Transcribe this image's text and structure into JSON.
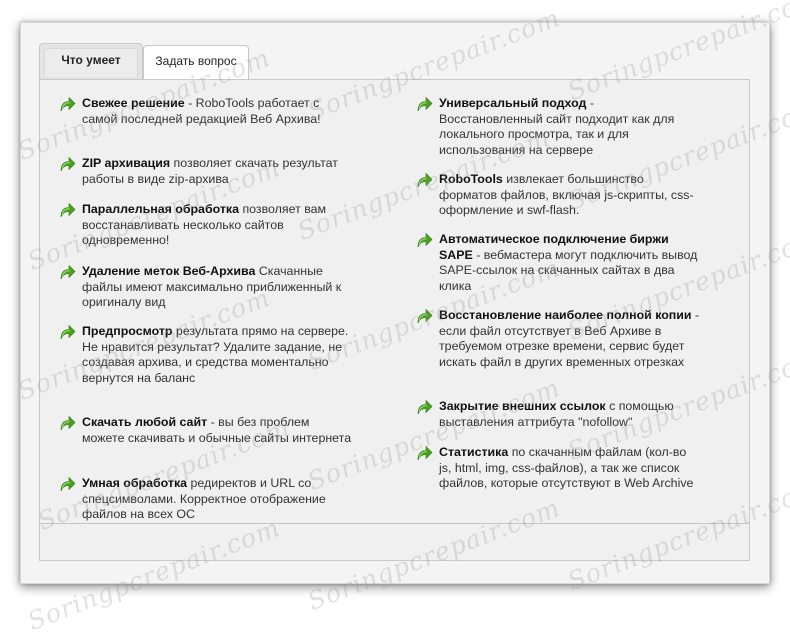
{
  "tabs": [
    {
      "label": "Что умеет",
      "active": true
    },
    {
      "label": "Задать вопрос",
      "active": false
    }
  ],
  "features_left": [
    {
      "title": "Свежее решение",
      "text": " - RoboTools работает с самой последней редакцией Веб Архива!"
    },
    {
      "title": "ZIP архивация",
      "text": " позволяет скачать результат работы в виде zip-архива"
    },
    {
      "title": "Параллельная обработка",
      "text": " позволяет вам восстанавливать несколько сайтов одновременно!"
    },
    {
      "title": "Удаление меток Веб-Архива",
      "text": " Скачанные файлы имеют максимально приближенный к оригиналу вид"
    },
    {
      "title": "Предпросмотр",
      "text": " результата прямо на сервере. Не нравится результат? Удалите задание, не создавая архива, и средства моментально вернутся на баланс"
    },
    {
      "title": "Скачать любой сайт",
      "text": " - вы без проблем можете скачивать и обычные сайты интернета"
    },
    {
      "title": "Умная обработка",
      "text": " редиректов и URL со спецсимволами. Корректное отображение файлов на всех ОС"
    }
  ],
  "features_right": [
    {
      "title": "Универсальный подход",
      "text": " - Восстановленный сайт подходит как для локального просмотра, так и для использования на сервере"
    },
    {
      "title": "RoboTools",
      "text": " извлекает большинство форматов файлов, включая js-скрипты, css-оформление и swf-flash."
    },
    {
      "title": "Автоматическое подключение биржи SAPE",
      "text": " - вебмастера могут подключить вывод SAPE-ссылок на скачанных сайтах в два клика"
    },
    {
      "title": "Восстановление наиболее полной копии",
      "text": " - если файл отсутствует в Веб Архиве в требуемом отрезке времени, сервис будет искать файл в других временных отрезках"
    },
    {
      "title": "Закрытие внешних ссылок",
      "text": " с помощью выставления аттрибута \"nofollow\""
    },
    {
      "title": "Статистика",
      "text": " по скачанным файлам (кол-во js, html, img, css-файлов), а так же список файлов, которые отсутствуют в Web Archive"
    }
  ],
  "watermark": "Soringpcrepair.com",
  "icons": {
    "bullet": "green-arrow-icon",
    "arrow_color": "#4aa21f"
  }
}
